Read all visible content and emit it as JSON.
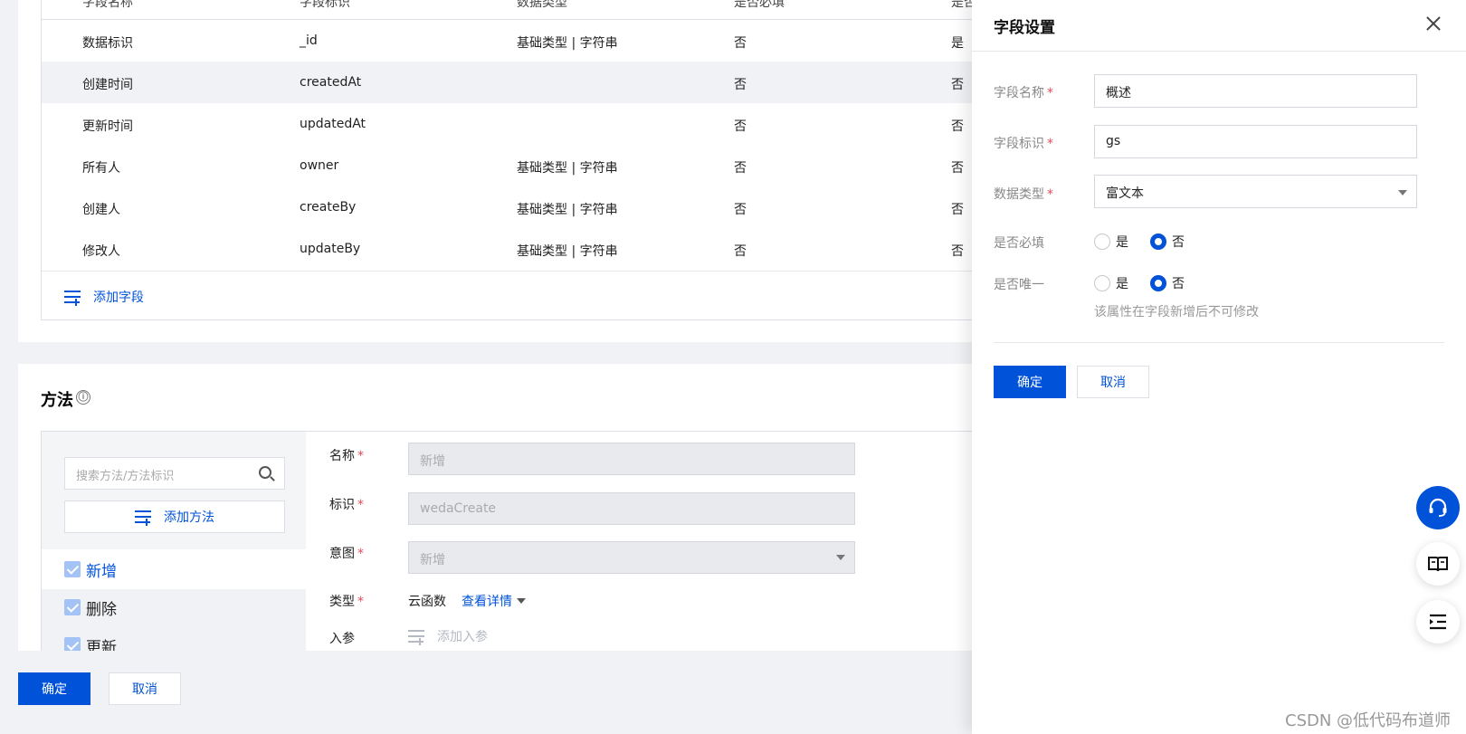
{
  "fields_table": {
    "headers": [
      "字段名称",
      "字段标识",
      "数据类型",
      "是否必填",
      "是否"
    ],
    "rows": [
      {
        "name": "数据标识",
        "id": "_id",
        "type": "基础类型 | 字符串",
        "required": "否",
        "unique": "是",
        "highlighted": false
      },
      {
        "name": "创建时间",
        "id": "createdAt",
        "type": "",
        "required": "否",
        "unique": "否",
        "highlighted": true
      },
      {
        "name": "更新时间",
        "id": "updatedAt",
        "type": "",
        "required": "否",
        "unique": "否",
        "highlighted": false
      },
      {
        "name": "所有人",
        "id": "owner",
        "type": "基础类型 | 字符串",
        "required": "否",
        "unique": "否",
        "highlighted": false
      },
      {
        "name": "创建人",
        "id": "createBy",
        "type": "基础类型 | 字符串",
        "required": "否",
        "unique": "否",
        "highlighted": false
      },
      {
        "name": "修改人",
        "id": "updateBy",
        "type": "基础类型 | 字符串",
        "required": "否",
        "unique": "否",
        "highlighted": false
      }
    ],
    "add_field_label": "添加字段"
  },
  "methods": {
    "title": "方法",
    "info_icon": "ⓘ",
    "search_placeholder": "搜索方法/方法标识",
    "add_method_label": "添加方法",
    "items": [
      "新增",
      "删除",
      "更新"
    ],
    "form": {
      "name_label": "名称",
      "name_value": "新增",
      "id_label": "标识",
      "id_value": "wedaCreate",
      "intent_label": "意图",
      "intent_value": "新增",
      "type_label": "类型",
      "type_value": "云函数",
      "type_link": "查看详情",
      "params_label": "入参",
      "add_param_label": "添加入参"
    },
    "required_mark": "*"
  },
  "bottom_buttons": {
    "confirm": "确定",
    "cancel": "取消"
  },
  "drawer": {
    "title": "字段设置",
    "field_name_label": "字段名称",
    "field_name_value": "概述",
    "field_id_label": "字段标识",
    "field_id_value": "gs",
    "data_type_label": "数据类型",
    "data_type_value": "富文本",
    "required_label": "是否必填",
    "unique_label": "是否唯一",
    "yes": "是",
    "no": "否",
    "required_selected": "否",
    "unique_selected": "否",
    "hint": "该属性在字段新增后不可修改",
    "confirm": "确定",
    "cancel": "取消",
    "required_mark": "*"
  },
  "floating_buttons": [
    "headset-icon",
    "book-icon",
    "outline-list-icon"
  ],
  "watermark": "CSDN @低代码布道师",
  "colors": {
    "primary": "#0052d9",
    "required": "#e34d59",
    "background": "#f0f2f5"
  }
}
